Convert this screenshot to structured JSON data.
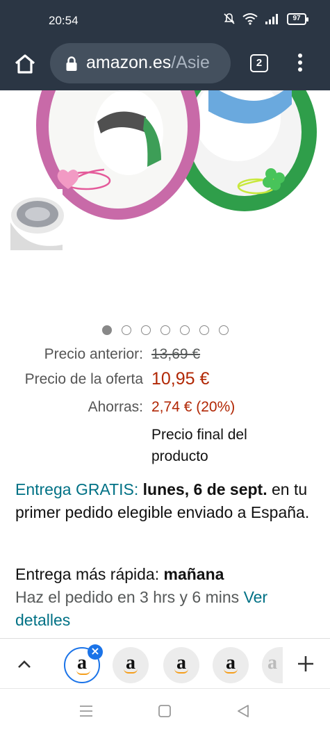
{
  "status_bar": {
    "time": "20:54",
    "battery": "97"
  },
  "toolbar": {
    "url_domain": "amazon.es",
    "url_path": "/Asie",
    "tab_count": "2"
  },
  "carousel": {
    "dot_count": 7,
    "active_index": 0
  },
  "price": {
    "previous_label": "Precio anterior:",
    "previous_value": "13,69 €",
    "deal_label": "Precio de la oferta",
    "deal_value": "10,95 €",
    "savings_label": "Ahorras:",
    "savings_value": "2,74 € (20%)",
    "final_note": "Precio final del producto"
  },
  "delivery": {
    "free_label": "Entrega GRATIS:",
    "date": "lunes, 6 de sept.",
    "rest": " en tu primer pedido elegible enviado a España."
  },
  "fastest": {
    "label": "Entrega más rápida: ",
    "date": "mañana",
    "order_text": "Haz el pedido en 3 hrs y 6 mins ",
    "details_link": "Ver detalles"
  },
  "tab_strip": {
    "tabs": [
      "a",
      "a",
      "a",
      "a",
      "a"
    ]
  },
  "colors": {
    "toolbar_bg": "#2b3644",
    "price_red": "#b12704",
    "link_teal": "#007185",
    "active_tab_blue": "#1a73e8"
  }
}
